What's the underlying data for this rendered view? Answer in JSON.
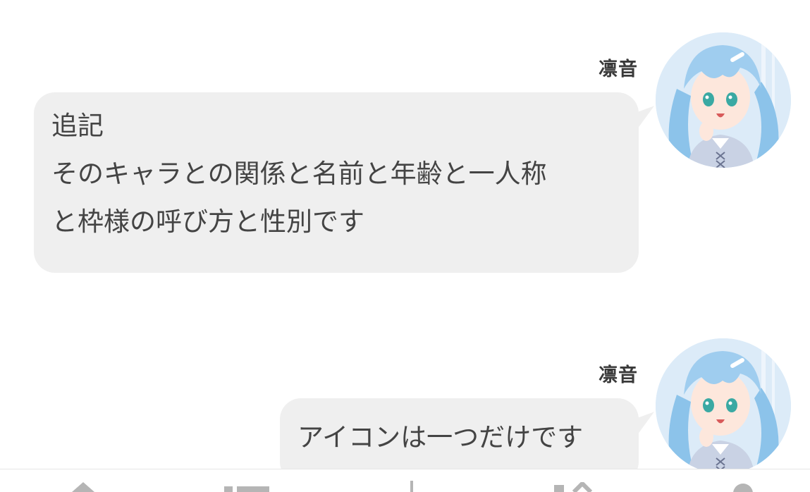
{
  "messages": [
    {
      "sender": "凛音",
      "lines": [
        "追記",
        "そのキャラとの関係と名前と年齢と一人称",
        "と枠様の呼び方と性別です"
      ]
    },
    {
      "sender": "凛音",
      "lines": [
        "アイコンは一つだけです"
      ]
    }
  ],
  "bottom_nav": {
    "icons": [
      "home-icon",
      "list-icon",
      "add-icon",
      "mail-icon",
      "profile-icon"
    ]
  },
  "colors": {
    "bubble": "#efefef",
    "text": "#444444",
    "sender": "#3a3a3a",
    "avatar_hair": "#9fcdef",
    "avatar_bg": "#dcebf8"
  }
}
